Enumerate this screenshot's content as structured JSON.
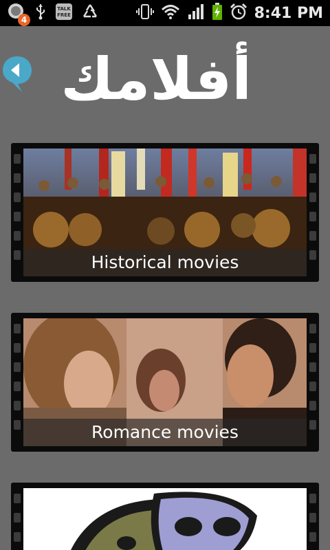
{
  "status_bar": {
    "notification_count": "4",
    "talk_label": "TALK\nFREE",
    "time": "8:41 PM"
  },
  "header": {
    "title": "أفلامك",
    "back_icon": "back-bubble-icon"
  },
  "categories": [
    {
      "caption": "Historical movies",
      "thumbnail": "historical-soldiers-image"
    },
    {
      "caption": "Romance movies",
      "thumbnail": "romance-couple-image"
    },
    {
      "caption": "",
      "thumbnail": "theatre-masks-image"
    }
  ],
  "colors": {
    "background": "#6b6b6b",
    "status_bar": "#000000",
    "accent": "#4aa8c9",
    "film_strip": "#0b0b0b"
  }
}
